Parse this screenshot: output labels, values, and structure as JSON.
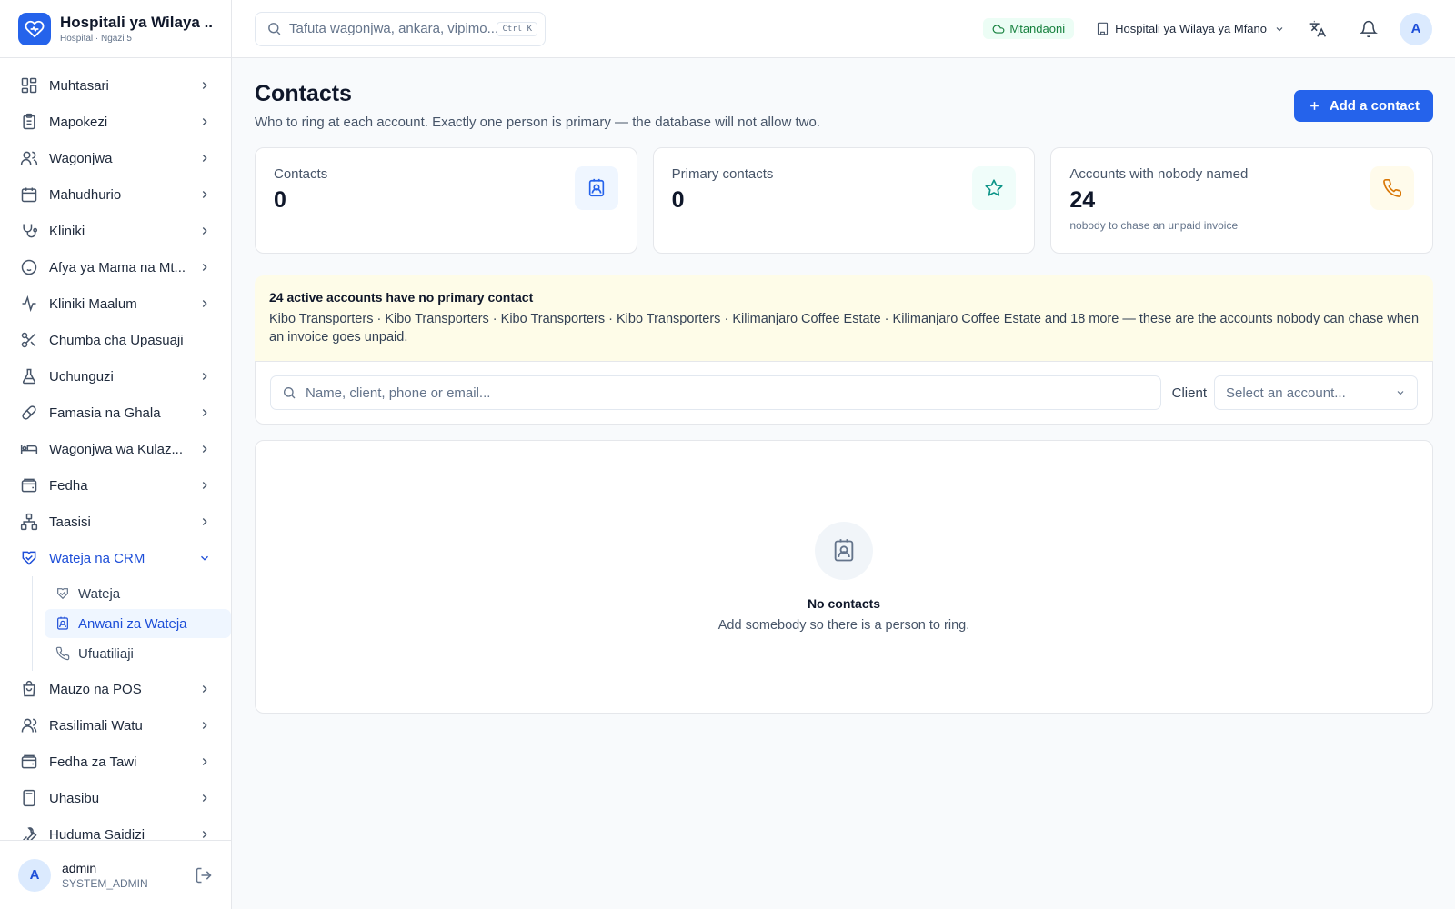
{
  "brand": {
    "title": "Hospitali ya Wilaya ...",
    "subtitle": "Hospital · Ngazi 5"
  },
  "search": {
    "placeholder": "Tafuta wagonjwa, ankara, vipimo...",
    "shortcut": "Ctrl K"
  },
  "topbar": {
    "status": "Mtandaoni",
    "facility": "Hospitali ya Wilaya ya Mfano",
    "avatar": "A"
  },
  "sidebar": {
    "items": [
      {
        "label": "Muhtasari",
        "icon": "dashboard-icon"
      },
      {
        "label": "Mapokezi",
        "icon": "clipboard-icon"
      },
      {
        "label": "Wagonjwa",
        "icon": "users-icon"
      },
      {
        "label": "Mahudhurio",
        "icon": "calendar-icon"
      },
      {
        "label": "Kliniki",
        "icon": "stethoscope-icon"
      },
      {
        "label": "Afya ya Mama na Mt...",
        "icon": "baby-icon"
      },
      {
        "label": "Kliniki Maalum",
        "icon": "activity-icon"
      },
      {
        "label": "Chumba cha Upasuaji",
        "icon": "scissors-icon"
      },
      {
        "label": "Uchunguzi",
        "icon": "flask-icon"
      },
      {
        "label": "Famasia na Ghala",
        "icon": "pill-icon"
      },
      {
        "label": "Wagonjwa wa Kulaz...",
        "icon": "bed-icon"
      },
      {
        "label": "Fedha",
        "icon": "wallet-icon"
      },
      {
        "label": "Taasisi",
        "icon": "network-icon"
      },
      {
        "label": "Wateja na CRM",
        "icon": "handshake-icon"
      },
      {
        "label": "Mauzo na POS",
        "icon": "shopping-bag-icon"
      },
      {
        "label": "Rasilimali Watu",
        "icon": "user-icon"
      },
      {
        "label": "Fedha za Tawi",
        "icon": "wallet-icon"
      },
      {
        "label": "Uhasibu",
        "icon": "calculator-icon"
      },
      {
        "label": "Huduma Saidizi",
        "icon": "wrench-icon"
      }
    ],
    "sub_items": [
      {
        "label": "Wateja",
        "icon": "handshake-icon"
      },
      {
        "label": "Anwani za Wateja",
        "icon": "contact-icon"
      },
      {
        "label": "Ufuatiliaji",
        "icon": "phone-icon"
      }
    ]
  },
  "user": {
    "name": "admin",
    "role": "SYSTEM_ADMIN",
    "initial": "A"
  },
  "page": {
    "title": "Contacts",
    "subtitle": "Who to ring at each account. Exactly one person is primary — the database will not allow two.",
    "add_button": "Add a contact"
  },
  "stats": [
    {
      "label": "Contacts",
      "value": "0",
      "note": "",
      "icon": "contact-icon",
      "color": "#2563eb",
      "bg": "#eff6ff"
    },
    {
      "label": "Primary contacts",
      "value": "0",
      "note": "",
      "icon": "star-icon",
      "color": "#0d9488",
      "bg": "#f0fdfa"
    },
    {
      "label": "Accounts with nobody named",
      "value": "24",
      "note": "nobody to chase an unpaid invoice",
      "icon": "phone-icon",
      "color": "#d97706",
      "bg": "#fffbeb"
    }
  ],
  "warning": {
    "title": "24 active accounts have no primary contact",
    "text": "Kibo Transporters · Kibo Transporters · Kibo Transporters · Kibo Transporters · Kilimanjaro Coffee Estate · Kilimanjaro Coffee Estate and 18 more — these are the accounts nobody can chase when an invoice goes unpaid."
  },
  "filters": {
    "search_placeholder": "Name, client, phone or email...",
    "client_label": "Client",
    "client_placeholder": "Select an account..."
  },
  "empty": {
    "title": "No contacts",
    "text": "Add somebody so there is a person to ring."
  }
}
